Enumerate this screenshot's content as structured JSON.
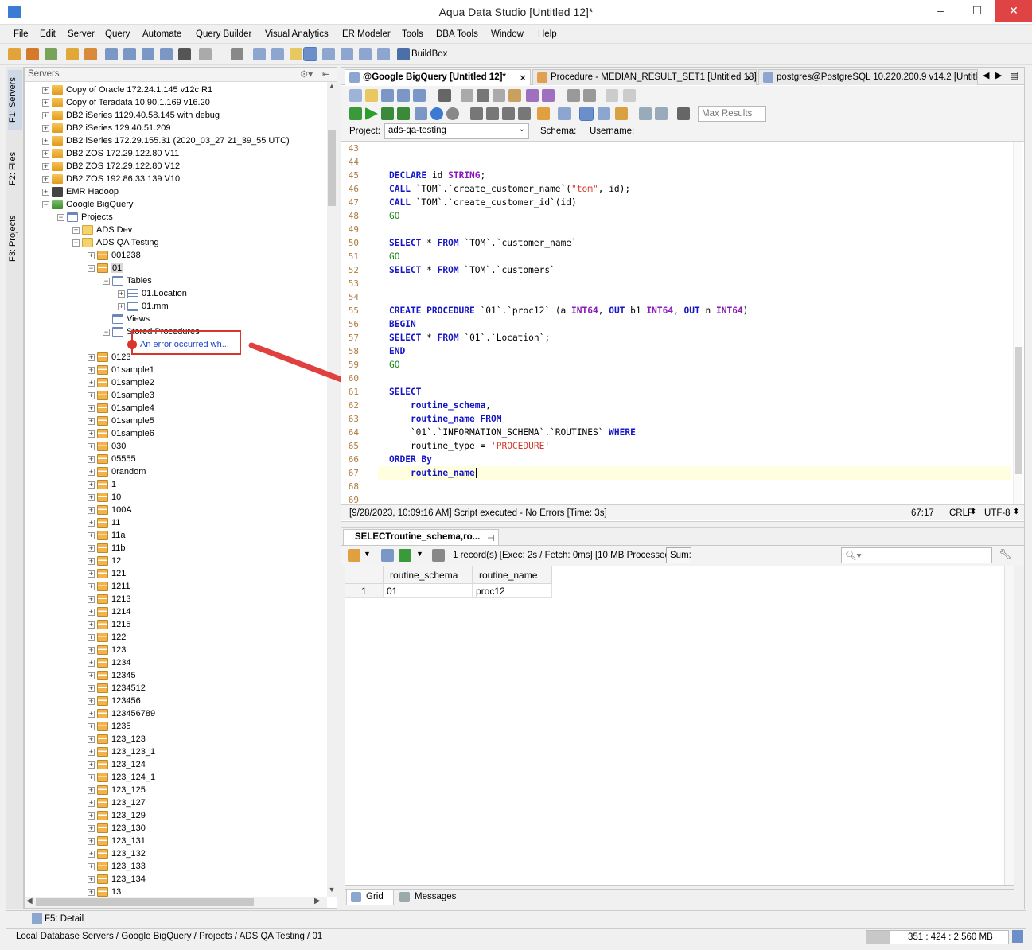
{
  "window": {
    "title": "Aqua Data Studio [Untitled 12]*",
    "min": "–",
    "max": "☐",
    "close": "✕"
  },
  "menu": [
    "File",
    "Edit",
    "Server",
    "Query",
    "Automate",
    "Query Builder",
    "Visual Analytics",
    "ER Modeler",
    "Tools",
    "DBA Tools",
    "Window",
    "Help"
  ],
  "toolbar": {
    "buildbox": "BuildBox"
  },
  "left_tabs": [
    "F1: Servers",
    "F2: Files",
    "F3: Projects"
  ],
  "servers": {
    "header": "Servers",
    "nodes": [
      {
        "label": "Copy of Oracle 172.24.1.145 v12c R1",
        "icon": "server-icon",
        "lvl": 1
      },
      {
        "label": "Copy of Teradata 10.90.1.169 v16.20",
        "icon": "server-icon",
        "lvl": 1
      },
      {
        "label": "DB2 iSeries 1129.40.58.145 with debug",
        "icon": "server-icon",
        "lvl": 1
      },
      {
        "label": "DB2 iSeries 129.40.51.209",
        "icon": "server-icon",
        "lvl": 1
      },
      {
        "label": "DB2 iSeries 172.29.155.31 (2020_03_27 21_39_55 UTC)",
        "icon": "server-icon",
        "lvl": 1
      },
      {
        "label": "DB2 ZOS 172.29.122.80 V11",
        "icon": "server-icon",
        "lvl": 1
      },
      {
        "label": "DB2 ZOS 172.29.122.80 V12",
        "icon": "server-icon",
        "lvl": 1
      },
      {
        "label": "DB2 ZOS 192.86.33.139 V10",
        "icon": "server-icon",
        "lvl": 1
      },
      {
        "label": "EMR Hadoop",
        "icon": "emr-icon",
        "lvl": 1
      },
      {
        "label": "Google BigQuery",
        "icon": "bigquery-icon",
        "lvl": 1,
        "open": true
      },
      {
        "label": "Projects",
        "icon": "projects-icon",
        "lvl": 2,
        "open": true
      },
      {
        "label": "ADS Dev",
        "icon": "folder-icon",
        "lvl": 3
      },
      {
        "label": "ADS QA Testing",
        "icon": "folder-icon",
        "lvl": 3,
        "open": true
      },
      {
        "label": "001238",
        "icon": "schema-icon",
        "lvl": 4
      },
      {
        "label": "01",
        "icon": "schema-icon",
        "lvl": 4,
        "open": true,
        "sel": true
      },
      {
        "label": "Tables",
        "icon": "tables-folder-icon",
        "lvl": 5,
        "open": true
      },
      {
        "label": "01.Location",
        "icon": "table-icon",
        "lvl": 6
      },
      {
        "label": "01.mm",
        "icon": "table-icon",
        "lvl": 6
      },
      {
        "label": "Views",
        "icon": "views-folder-icon",
        "lvl": 5,
        "leaf": true
      },
      {
        "label": "Stored Procedures",
        "icon": "procs-folder-icon",
        "lvl": 5,
        "open": true
      },
      {
        "label": "An error occurred wh...",
        "icon": "error-icon",
        "lvl": 6,
        "leaf": true,
        "err": true
      },
      {
        "label": "0123",
        "icon": "schema-icon",
        "lvl": 4
      },
      {
        "label": "01sample1",
        "icon": "schema-icon",
        "lvl": 4
      },
      {
        "label": "01sample2",
        "icon": "schema-icon",
        "lvl": 4
      },
      {
        "label": "01sample3",
        "icon": "schema-icon",
        "lvl": 4
      },
      {
        "label": "01sample4",
        "icon": "schema-icon",
        "lvl": 4
      },
      {
        "label": "01sample5",
        "icon": "schema-icon",
        "lvl": 4
      },
      {
        "label": "01sample6",
        "icon": "schema-icon",
        "lvl": 4
      },
      {
        "label": "030",
        "icon": "schema-icon",
        "lvl": 4
      },
      {
        "label": "05555",
        "icon": "schema-icon",
        "lvl": 4
      },
      {
        "label": "0random",
        "icon": "schema-icon",
        "lvl": 4
      },
      {
        "label": "1",
        "icon": "schema-icon",
        "lvl": 4
      },
      {
        "label": "10",
        "icon": "schema-icon",
        "lvl": 4
      },
      {
        "label": "100A",
        "icon": "schema-icon",
        "lvl": 4
      },
      {
        "label": "11",
        "icon": "schema-icon",
        "lvl": 4
      },
      {
        "label": "11a",
        "icon": "schema-icon",
        "lvl": 4
      },
      {
        "label": "11b",
        "icon": "schema-icon",
        "lvl": 4
      },
      {
        "label": "12",
        "icon": "schema-icon",
        "lvl": 4
      },
      {
        "label": "121",
        "icon": "schema-icon",
        "lvl": 4
      },
      {
        "label": "1211",
        "icon": "schema-icon",
        "lvl": 4
      },
      {
        "label": "1213",
        "icon": "schema-icon",
        "lvl": 4
      },
      {
        "label": "1214",
        "icon": "schema-icon",
        "lvl": 4
      },
      {
        "label": "1215",
        "icon": "schema-icon",
        "lvl": 4
      },
      {
        "label": "122",
        "icon": "schema-icon",
        "lvl": 4
      },
      {
        "label": "123",
        "icon": "schema-icon",
        "lvl": 4
      },
      {
        "label": "1234",
        "icon": "schema-icon",
        "lvl": 4
      },
      {
        "label": "12345",
        "icon": "schema-icon",
        "lvl": 4
      },
      {
        "label": "1234512",
        "icon": "schema-icon",
        "lvl": 4
      },
      {
        "label": "123456",
        "icon": "schema-icon",
        "lvl": 4
      },
      {
        "label": "123456789",
        "icon": "schema-icon",
        "lvl": 4
      },
      {
        "label": "1235",
        "icon": "schema-icon",
        "lvl": 4
      },
      {
        "label": "123_123",
        "icon": "schema-icon",
        "lvl": 4
      },
      {
        "label": "123_123_1",
        "icon": "schema-icon",
        "lvl": 4
      },
      {
        "label": "123_124",
        "icon": "schema-icon",
        "lvl": 4
      },
      {
        "label": "123_124_1",
        "icon": "schema-icon",
        "lvl": 4
      },
      {
        "label": "123_125",
        "icon": "schema-icon",
        "lvl": 4
      },
      {
        "label": "123_127",
        "icon": "schema-icon",
        "lvl": 4
      },
      {
        "label": "123_129",
        "icon": "schema-icon",
        "lvl": 4
      },
      {
        "label": "123_130",
        "icon": "schema-icon",
        "lvl": 4
      },
      {
        "label": "123_131",
        "icon": "schema-icon",
        "lvl": 4
      },
      {
        "label": "123_132",
        "icon": "schema-icon",
        "lvl": 4
      },
      {
        "label": "123_133",
        "icon": "schema-icon",
        "lvl": 4
      },
      {
        "label": "123_134",
        "icon": "schema-icon",
        "lvl": 4
      },
      {
        "label": "13",
        "icon": "schema-icon",
        "lvl": 4
      }
    ]
  },
  "editor_tabs": [
    {
      "label": "@Google BigQuery [Untitled 12]*",
      "active": true,
      "close": "✕"
    },
    {
      "label": "Procedure - MEDIAN_RESULT_SET1 [Untitled 13]",
      "close": "✕"
    },
    {
      "label": "postgres@PostgreSQL 10.220.200.9 v14.2 [Untitlec",
      "close": ""
    }
  ],
  "editor": {
    "max_results_placeholder": "Max Results",
    "project_label": "Project:",
    "project_value": "ads-qa-testing",
    "schema_label": "Schema:",
    "username_label": "Username:",
    "lines": [
      {
        "n": "43",
        "html": ""
      },
      {
        "n": "44",
        "html": ""
      },
      {
        "n": "45",
        "html": "<span class='kw'>DECLARE</span> id <span class='ty'>STRING</span>;"
      },
      {
        "n": "46",
        "html": "<span class='kw'>CALL</span> `TOM`.`create_customer_name`(<span class='st'>\"tom\"</span>, id);"
      },
      {
        "n": "47",
        "html": "<span class='kw'>CALL</span> `TOM`.`create_customer_id`(id)"
      },
      {
        "n": "48",
        "html": "<span class='go'>GO</span>"
      },
      {
        "n": "49",
        "html": ""
      },
      {
        "n": "50",
        "html": "<span class='kw'>SELECT</span> * <span class='kw'>FROM</span> `TOM`.`customer_name`"
      },
      {
        "n": "51",
        "html": "<span class='go'>GO</span>"
      },
      {
        "n": "52",
        "html": "<span class='kw'>SELECT</span> * <span class='kw'>FROM</span> `TOM`.`customers`"
      },
      {
        "n": "53",
        "html": ""
      },
      {
        "n": "54",
        "html": ""
      },
      {
        "n": "55",
        "html": "<span class='kw'>CREATE PROCEDURE</span> `01`.`proc12` (a <span class='ty'>INT64</span>, <span class='kw'>OUT</span> b1 <span class='ty'>INT64</span>, <span class='kw'>OUT</span> n <span class='ty'>INT64</span>)"
      },
      {
        "n": "56",
        "html": "<span class='kw'>BEGIN</span>"
      },
      {
        "n": "57",
        "html": "<span class='kw'>SELECT</span> * <span class='kw'>FROM</span> `01`.`Location`;"
      },
      {
        "n": "58",
        "html": "<span class='kw'>END</span>"
      },
      {
        "n": "59",
        "html": "<span class='go'>GO</span>"
      },
      {
        "n": "60",
        "html": ""
      },
      {
        "n": "61",
        "html": "<span class='kw'>SELECT</span>"
      },
      {
        "n": "62",
        "html": "    <span class='kw'>routine_schema</span>,"
      },
      {
        "n": "63",
        "html": "    <span class='kw'>routine_name FROM</span>"
      },
      {
        "n": "64",
        "html": "    `01`.`INFORMATION_SCHEMA`.`ROUTINES` <span class='kw'>WHERE</span>"
      },
      {
        "n": "65",
        "html": "    routine_type = <span class='st'>'PROCEDURE'</span>"
      },
      {
        "n": "66",
        "html": "<span class='kw'>ORDER By</span>"
      },
      {
        "n": "67",
        "html": "    <span class='kw'>routine_name</span>",
        "cur": true
      },
      {
        "n": "68",
        "html": ""
      },
      {
        "n": "69",
        "html": ""
      }
    ],
    "status": "[9/28/2023, 10:09:16 AM] Script executed - No Errors [Time: 3s]",
    "position": "67:17",
    "line_ending": "CRLF",
    "encoding": "UTF-8"
  },
  "results": {
    "tab_label": "SELECTroutine_schema,ro...",
    "summary": "1 record(s) [Exec: 2s / Fetch: 0ms] [10 MB Processed]",
    "sum_button": "Sum:",
    "columns": [
      "routine_schema",
      "routine_name"
    ],
    "rows": [
      {
        "n": "1",
        "cells": [
          "01",
          "proc12"
        ]
      }
    ],
    "bottom_tabs": [
      "Grid",
      "Messages"
    ]
  },
  "bottombar": {
    "detail": "F5: Detail"
  },
  "statusbar": {
    "breadcrumb": "Local Database Servers / Google BigQuery / Projects / ADS QA Testing / 01",
    "memory": "351 : 424 : 2,560 MB"
  },
  "colors": {
    "keyword": "#1515c8",
    "type": "#8a1ab8",
    "string": "#d23a2a",
    "go": "#1a8a1a",
    "error_box": "#d9352c",
    "arrow": "#e04040"
  }
}
